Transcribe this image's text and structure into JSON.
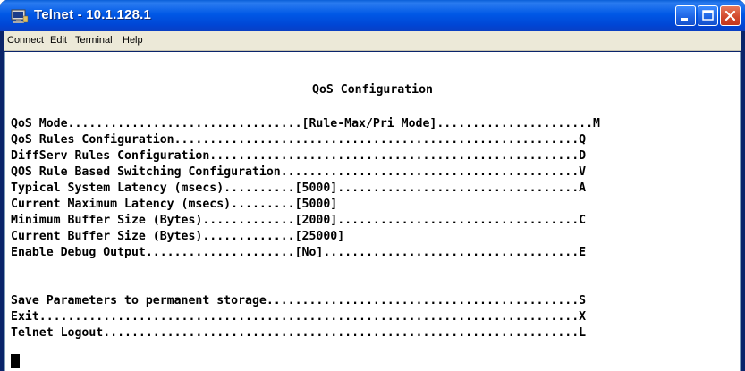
{
  "window": {
    "title": "Telnet - 10.1.128.1",
    "controls": [
      "minimize",
      "maximize",
      "close"
    ]
  },
  "menu": {
    "connect": "Connect",
    "edit": "Edit",
    "terminal": "Terminal",
    "help": "Help"
  },
  "terminal": {
    "heading": "QoS Configuration",
    "lines": [
      "QoS Mode.................................[Rule-Max/Pri Mode]......................M",
      "QoS Rules Configuration.........................................................Q",
      "DiffServ Rules Configuration....................................................D",
      "QOS Rule Based Switching Configuration..........................................V",
      "Typical System Latency (msecs)..........[5000]..................................A",
      "Current Maximum Latency (msecs).........[5000]",
      "Minimum Buffer Size (Bytes).............[2000]..................................C",
      "Current Buffer Size (Bytes).............[25000]",
      "Enable Debug Output.....................[No]....................................E",
      "Save Parameters to permanent storage............................................S",
      "Exit............................................................................X",
      "Telnet Logout...................................................................L"
    ]
  }
}
